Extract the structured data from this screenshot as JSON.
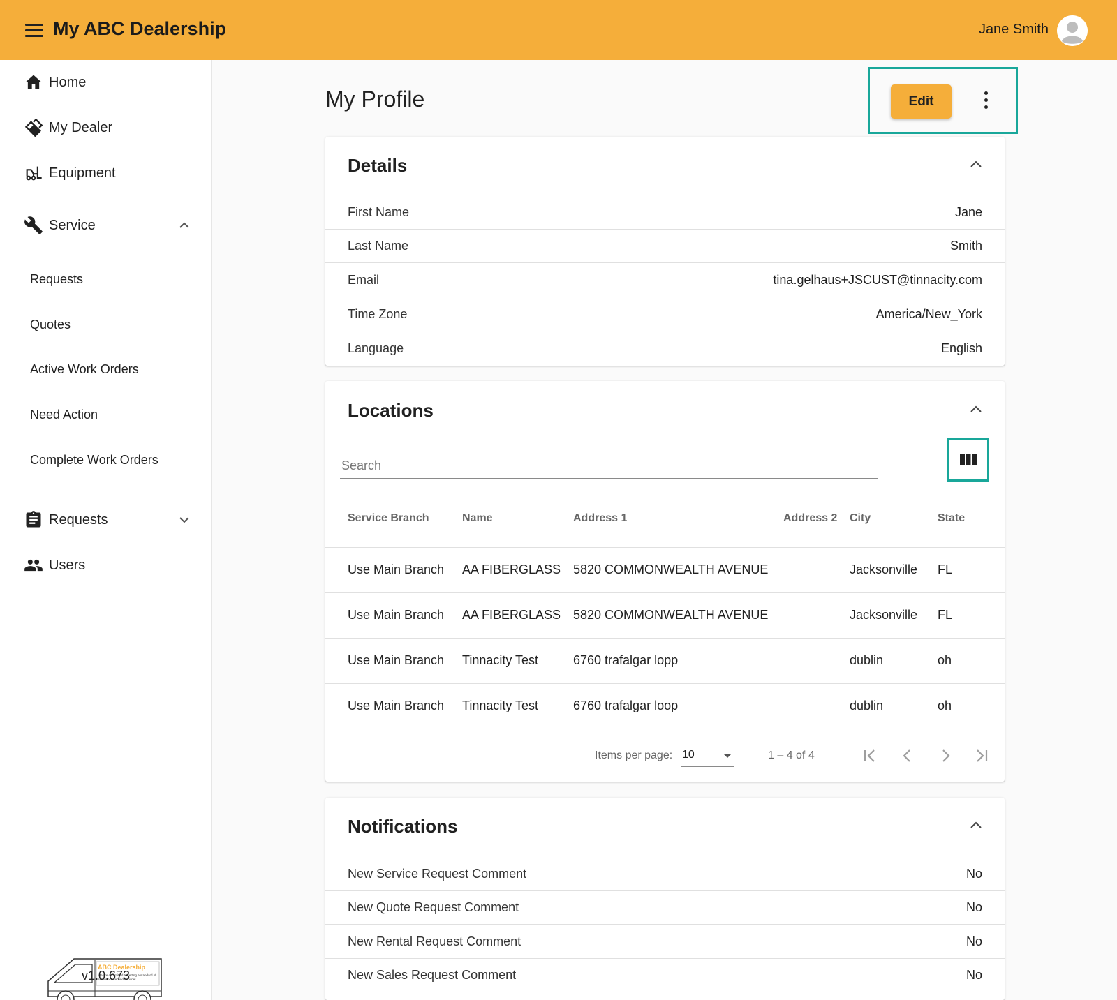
{
  "app": {
    "title": "My ABC Dealership",
    "user_name": "Jane Smith",
    "version": "v1.0.673"
  },
  "sidebar": {
    "home": "Home",
    "my_dealer": "My Dealer",
    "equipment": "Equipment",
    "service": "Service",
    "service_items": [
      "Requests",
      "Quotes",
      "Active Work Orders",
      "Need Action",
      "Complete Work Orders"
    ],
    "requests": "Requests",
    "users": "Users",
    "logo_text": "ABC Dealership",
    "logo_tagline": "We are committed to setting a standard of excellence second to none!"
  },
  "page": {
    "title": "My Profile",
    "edit_label": "Edit"
  },
  "details": {
    "title": "Details",
    "rows": [
      {
        "key": "First Name",
        "value": "Jane"
      },
      {
        "key": "Last Name",
        "value": "Smith"
      },
      {
        "key": "Email",
        "value": "tina.gelhaus+JSCUST@tinnacity.com"
      },
      {
        "key": "Time Zone",
        "value": "America/New_York"
      },
      {
        "key": "Language",
        "value": "English"
      }
    ]
  },
  "locations": {
    "title": "Locations",
    "search_placeholder": "Search",
    "columns": [
      "Service Branch",
      "Name",
      "Address 1",
      "Address 2",
      "City",
      "State"
    ],
    "rows": [
      [
        "Use Main Branch",
        "AA FIBERGLASS",
        "5820 COMMONWEALTH AVENUE",
        "",
        "Jacksonville",
        "FL"
      ],
      [
        "Use Main Branch",
        "AA FIBERGLASS",
        "5820 COMMONWEALTH AVENUE",
        "",
        "Jacksonville",
        "FL"
      ],
      [
        "Use Main Branch",
        "Tinnacity Test",
        "6760 trafalgar lopp",
        "",
        "dublin",
        "oh"
      ],
      [
        "Use Main Branch",
        "Tinnacity Test",
        "6760 trafalgar loop",
        "",
        "dublin",
        "oh"
      ]
    ],
    "items_per_page_label": "Items per page:",
    "items_per_page": "10",
    "range": "1 – 4 of 4"
  },
  "notifications": {
    "title": "Notifications",
    "rows": [
      {
        "key": "New Service Request Comment",
        "value": "No"
      },
      {
        "key": "New Quote Request Comment",
        "value": "No"
      },
      {
        "key": "New Rental Request Comment",
        "value": "No"
      },
      {
        "key": "New Sales Request Comment",
        "value": "No"
      }
    ]
  },
  "colors": {
    "brand": "#f5ae3a",
    "highlight": "#19a79a"
  }
}
